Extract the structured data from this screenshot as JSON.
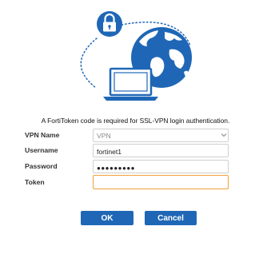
{
  "message": "A FortiToken code is required for SSL-VPN login authentication.",
  "form": {
    "vpn_name": {
      "label": "VPN Name",
      "value": "VPN",
      "options": [
        "VPN"
      ]
    },
    "username": {
      "label": "Username",
      "value": "fortinet1"
    },
    "password": {
      "label": "Password",
      "value": "●●●●●●●●●"
    },
    "token": {
      "label": "Token",
      "value": "",
      "state": "focused"
    }
  },
  "buttons": {
    "ok": "OK",
    "cancel": "Cancel"
  },
  "colors": {
    "brand_blue": "#1f67b6",
    "focus_orange": "#f2a13b",
    "field_border": "#cfcfcf"
  },
  "icons": [
    "lock-icon",
    "globe-icon",
    "laptop-icon",
    "chevron-down-icon"
  ]
}
